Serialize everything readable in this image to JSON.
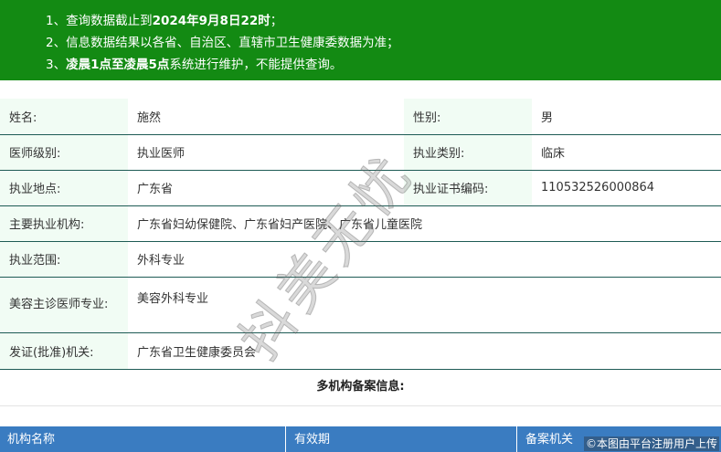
{
  "notice": {
    "line1_prefix": "1、查询数据截止到",
    "line1_bold": "2024年9月8日22时",
    "line1_suffix": "；",
    "line2": "2、信息数据结果以各省、自治区、直辖市卫生健康委数据为准；",
    "line3_prefix": "3、",
    "line3_bold": "凌晨1点至凌晨5点",
    "line3_suffix": "系统进行维护，不能提供查询。"
  },
  "info": {
    "name_label": "姓名:",
    "name_value": "施然",
    "gender_label": "性别:",
    "gender_value": "男",
    "level_label": "医师级别:",
    "level_value": "执业医师",
    "category_label": "执业类别:",
    "category_value": "临床",
    "location_label": "执业地点:",
    "location_value": "广东省",
    "cert_label": "执业证书编码:",
    "cert_value": "110532526000864",
    "org_label": "主要执业机构:",
    "org_value": "广东省妇幼保健院、广东省妇产医院、广东省儿童医院",
    "scope_label": "执业范围:",
    "scope_value": "外科专业",
    "cosmetic_label": "美容主诊医师专业:",
    "cosmetic_value": "美容外科专业",
    "authority_label": "发证(批准)机关:",
    "authority_value": "广东省卫生健康委员会"
  },
  "multi_org": {
    "title": "多机构备案信息:",
    "col_name": "机构名称",
    "col_validity": "有效期",
    "col_authority": "备案机关"
  },
  "watermark": "抖美无忧",
  "credit": "©本图由平台注册用户上传"
}
